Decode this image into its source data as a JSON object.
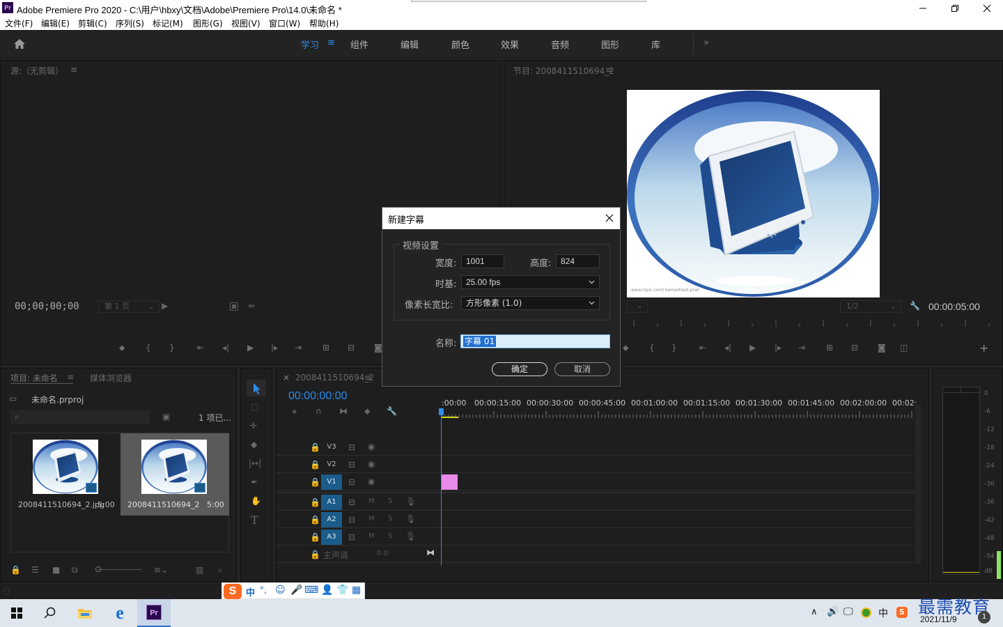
{
  "window": {
    "app_badge": "Pr",
    "title": "Adobe Premiere Pro 2020 - C:\\用户\\hbxy\\文档\\Adobe\\Premiere Pro\\14.0\\未命名 *"
  },
  "menu": [
    "文件(F)",
    "编辑(E)",
    "剪辑(C)",
    "序列(S)",
    "标记(M)",
    "图形(G)",
    "视图(V)",
    "窗口(W)",
    "帮助(H)"
  ],
  "workspaces": {
    "active": "学习",
    "items": [
      "学习",
      "组件",
      "编辑",
      "颜色",
      "效果",
      "音频",
      "图形",
      "库"
    ]
  },
  "source_monitor": {
    "title": "源:（无剪辑）",
    "timecode": "00;00;00;00",
    "page": "第 1 页"
  },
  "program_monitor": {
    "title": "节目: 2008411510694_2",
    "fraction": "1/2",
    "duration": "00:00:05:00",
    "watermark": "www.nipic.com/ kamashaizi.pnel"
  },
  "dialog": {
    "title": "新建字幕",
    "group": "视频设置",
    "width_label": "宽度:",
    "width": "1001",
    "height_label": "高度:",
    "height": "824",
    "timebase_label": "时基:",
    "timebase": "25.00 fps",
    "par_label": "像素长宽比:",
    "par": "方形像素 (1.0)",
    "name_label": "名称:",
    "name": "字幕 01",
    "ok": "确定",
    "cancel": "取消"
  },
  "project": {
    "tab": "项目: 未命名",
    "tab2": "媒体浏览器",
    "file": "未命名.prproj",
    "count": "1 项已...",
    "items": [
      {
        "name": "2008411510694_2.jpg",
        "duration": "5:00"
      },
      {
        "name": "2008411510694_2",
        "duration": "5:00"
      }
    ]
  },
  "timeline": {
    "tab": "2008411510694_2",
    "timecode": "00:00:00:00",
    "ruler": [
      ":00:00",
      "00:00:15:00",
      "00:00:30:00",
      "00:00:45:00",
      "00:01:00:00",
      "00:01:15:00",
      "00:01:30:00",
      "00:01:45:00",
      "00:02:00:00",
      "00:02:"
    ],
    "video_tracks": [
      "V3",
      "V2",
      "V1"
    ],
    "audio_tracks": [
      "A1",
      "A2",
      "A3"
    ],
    "mute": "M",
    "solo": "S",
    "master": "主声道",
    "master_value": "0.0",
    "clip_color": "#e88ae8"
  },
  "meter": {
    "ticks": [
      "0",
      "-6",
      "-12",
      "-18",
      "-24",
      "-30",
      "-36",
      "-42",
      "-48",
      "-54",
      "dB"
    ]
  },
  "ime": {
    "glyph": "S",
    "mode": "中",
    "punct": "°,"
  },
  "taskbar": {
    "ime_tray": "中",
    "date": "2021/11/9",
    "watermark": "最需教育",
    "notify_count": "1"
  },
  "colors": {
    "accent": "#2d8ceb",
    "track_on": "#1b5c8a",
    "playhead": "#2d8ceb",
    "clip": "#e88ae8"
  }
}
